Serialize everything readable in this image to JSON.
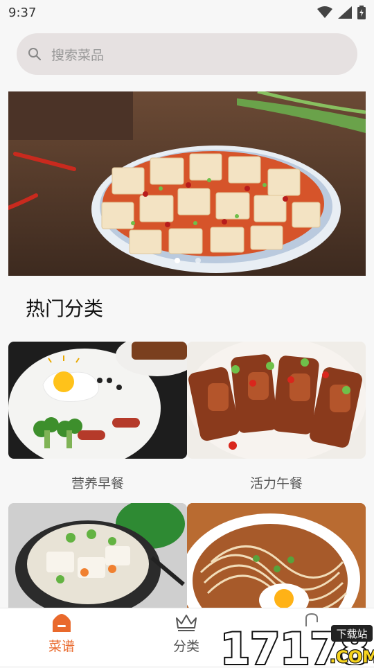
{
  "status_bar": {
    "time": "9:37",
    "icons": [
      "wifi-icon",
      "signal-icon",
      "battery-charging-icon"
    ]
  },
  "search": {
    "placeholder": "搜索菜品",
    "icon": "search-icon"
  },
  "banner": {
    "image": "mapo-tofu-photo",
    "indicator_count": 2,
    "active_index": 0
  },
  "section": {
    "title": "热门分类"
  },
  "categories": [
    {
      "label": "营养早餐",
      "image": "breakfast-plate-photo"
    },
    {
      "label": "活力午餐",
      "image": "ribs-lunch-photo"
    },
    {
      "label": "",
      "image": "claypot-tofu-photo"
    },
    {
      "label": "",
      "image": "noodle-bowl-photo"
    }
  ],
  "tabs": [
    {
      "label": "菜谱",
      "icon": "home-icon",
      "active": true
    },
    {
      "label": "分类",
      "icon": "crown-icon",
      "active": false
    }
  ],
  "watermark": {
    "text": "17178",
    "sub": "下载站",
    "domain": ".COM"
  },
  "colors": {
    "accent": "#e9692c",
    "tab_inactive": "#555555",
    "search_bg": "#e6e1e1"
  }
}
